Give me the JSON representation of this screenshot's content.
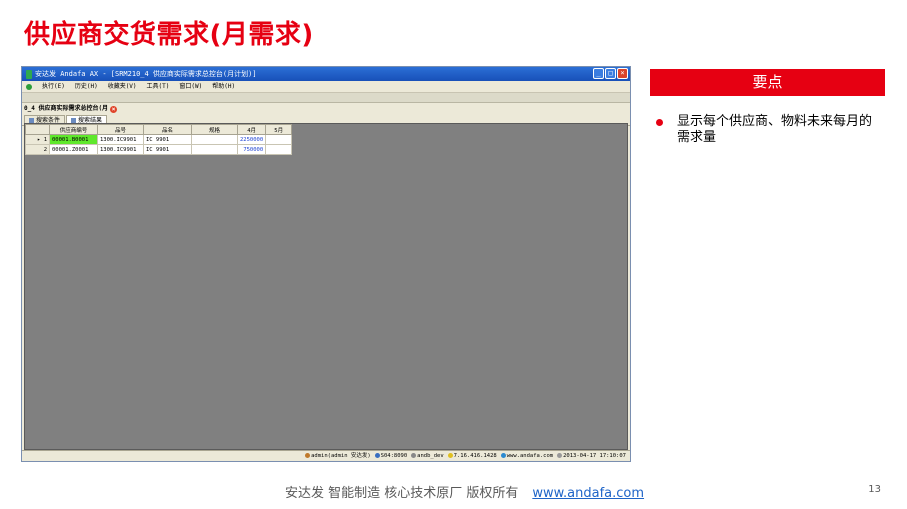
{
  "slide": {
    "title": "供应商交货需求(月需求)",
    "keypoint_header": "要点",
    "bullet": "显示每个供应商、物料未来每月的需求量",
    "footer_text": "安达发  智能制造 核心技术原厂   版权所有",
    "footer_link": "www.andafa.com",
    "page_number": "13",
    "accent_color": "#e60012"
  },
  "app": {
    "window_title": "安达发 Andafa AX - [SRM210_4 供应商实际需求总控台(月计划)]",
    "menu": [
      "执行(E)",
      "历史(H)",
      "收藏夹(V)",
      "工具(T)",
      "窗口(W)",
      "帮助(H)"
    ],
    "doc_tab": "0_4 供应商实际需求总控台(月",
    "subtabs": [
      "搜索条件",
      "搜索结果"
    ],
    "grid": {
      "columns": [
        "",
        "供应商编号",
        "品号",
        "品名",
        "规格",
        "4月",
        "5月"
      ],
      "rows": [
        {
          "no": "1",
          "supplier": "00001.B0001",
          "item": "1300.IC9901",
          "name": "IC 9901",
          "spec": "",
          "apr": "2250000",
          "may": ""
        },
        {
          "no": "2",
          "supplier": "00001.Z0001",
          "item": "1300.IC9901",
          "name": "IC 9901",
          "spec": "",
          "apr": "750000",
          "may": ""
        }
      ]
    },
    "status": {
      "user": "admin(admin 安达发)",
      "server": "S04:8090",
      "db": "andb_dev",
      "ip": "7.16.416.1428",
      "site": "www.andafa.com",
      "datetime": "2013-04-17 17:10:07"
    }
  }
}
